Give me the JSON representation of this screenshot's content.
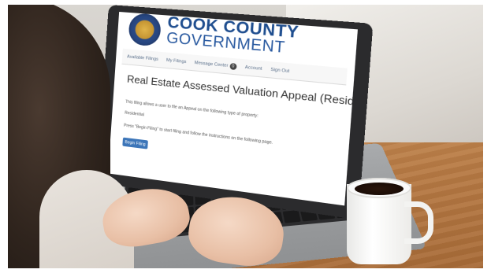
{
  "site": {
    "brand_line1": "COOK COUNTY",
    "brand_line2": "GOVERNMENT"
  },
  "nav": {
    "items": [
      "Available Filings",
      "My Filings",
      "Message Center",
      "Account",
      "Sign Out"
    ],
    "message_count": "0"
  },
  "page": {
    "title": "Real Estate Assessed Valuation Appeal (Residential)",
    "paragraph1": "This filing allows a user to file an Appeal on the following type of property:",
    "paragraph2": "Residential",
    "paragraph3": "Press \"Begin Filing\" to start filing and follow the instructions on the following page.",
    "begin_button": "Begin Filing"
  }
}
